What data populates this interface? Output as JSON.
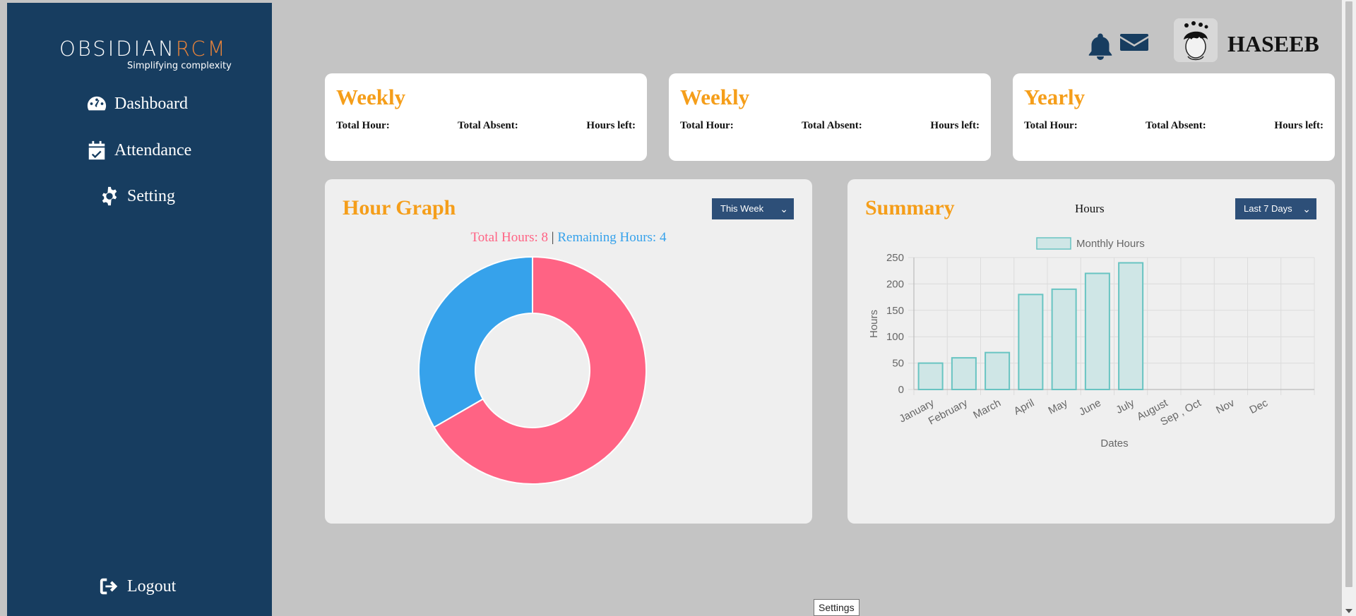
{
  "brand": {
    "logo_main": "OBSIDIAN",
    "logo_accent": "RCM",
    "tagline": "Simplifying complexity"
  },
  "sidebar": {
    "items": [
      {
        "label": "Dashboard",
        "icon": "dashboard-gauge-icon"
      },
      {
        "label": "Attendance",
        "icon": "calendar-check-icon"
      },
      {
        "label": "Setting",
        "icon": "gear-icon"
      }
    ],
    "logout_label": "Logout",
    "logout_icon": "logout-icon"
  },
  "header": {
    "username": "HASEEB",
    "bell_icon": "bell-icon",
    "mail_icon": "envelope-icon"
  },
  "cards": [
    {
      "title": "Weekly",
      "total_hour": "Total Hour:",
      "total_absent": "Total Absent:",
      "hours_left": "Hours left:"
    },
    {
      "title": "Weekly",
      "total_hour": "Total Hour:",
      "total_absent": "Total Absent:",
      "hours_left": "Hours left:"
    },
    {
      "title": "Yearly",
      "total_hour": "Total Hour:",
      "total_absent": "Total Absent:",
      "hours_left": "Hours left:"
    }
  ],
  "hour_graph": {
    "title": "Hour Graph",
    "dropdown": "This Week",
    "total_label": "Total Hours: 8",
    "separator": "|",
    "remaining_label": "Remaining Hours: 4"
  },
  "summary": {
    "title": "Summary",
    "center_label": "Hours",
    "dropdown": "Last 7 Days"
  },
  "tooltip": "Settings",
  "colors": {
    "sidebar": "#173d60",
    "accent_orange": "#f59e1a",
    "pink": "#ff6384",
    "blue": "#36a2eb",
    "teal_fill": "#cfe6e6",
    "teal_stroke": "#68c4c2"
  },
  "chart_data": [
    {
      "type": "pie",
      "labels": [
        "Total Hours",
        "Remaining Hours"
      ],
      "values": [
        8,
        4
      ],
      "colors": [
        "#ff6384",
        "#36a2eb"
      ]
    },
    {
      "type": "bar",
      "categories": [
        "January",
        "February",
        "March",
        "April",
        "May",
        "June",
        "July",
        "August",
        "Sep , Oct",
        "Nov",
        "Dec"
      ],
      "series": [
        {
          "name": "Monthly Hours",
          "values": [
            50,
            60,
            70,
            180,
            190,
            220,
            240,
            null,
            null,
            null,
            null
          ]
        }
      ],
      "xlabel": "Dates",
      "ylabel": "Hours",
      "ylim": [
        0,
        250
      ],
      "yticks": [
        0,
        50,
        100,
        150,
        200,
        250
      ],
      "grid": true,
      "legend": "top"
    }
  ]
}
